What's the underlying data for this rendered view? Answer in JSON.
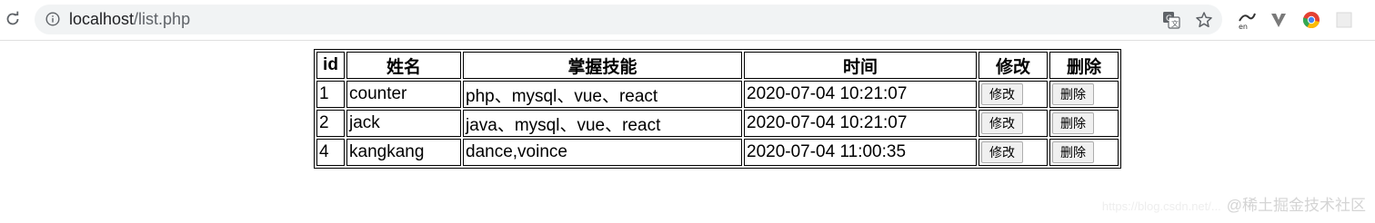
{
  "browser": {
    "url_host": "localhost",
    "url_path": "/list.php",
    "icons": [
      "reload-icon",
      "site-info-icon",
      "translate-icon",
      "bookmark-star-icon",
      "enable-extension-icon",
      "vivaldi-extension-icon",
      "chrome-icon",
      "extension-icon"
    ]
  },
  "table": {
    "headers": {
      "id": "id",
      "name": "姓名",
      "skills": "掌握技能",
      "time": "时间",
      "edit": "修改",
      "delete": "删除"
    },
    "rows": [
      {
        "id": "1",
        "name": "counter",
        "skills": "php、mysql、vue、react",
        "time": "2020-07-04 10:21:07",
        "edit_label": "修改",
        "delete_label": "删除"
      },
      {
        "id": "2",
        "name": "jack",
        "skills": "java、mysql、vue、react",
        "time": "2020-07-04 10:21:07",
        "edit_label": "修改",
        "delete_label": "删除"
      },
      {
        "id": "4",
        "name": "kangkang",
        "skills": "dance,voince",
        "time": "2020-07-04 11:00:35",
        "edit_label": "修改",
        "delete_label": "删除"
      }
    ]
  },
  "watermark": {
    "faint_text": "https://blog.csdn.net/...",
    "text": "@稀土掘金技术社区"
  }
}
